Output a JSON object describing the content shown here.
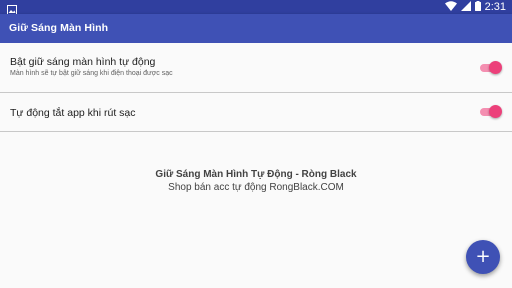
{
  "status_bar": {
    "time": "2:31",
    "left_icon": "image-icon",
    "icons": [
      "wifi-icon",
      "signal-icon",
      "battery-icon"
    ]
  },
  "app_bar": {
    "title": "Giữ Sáng Màn Hình"
  },
  "preferences": [
    {
      "title": "Bật giữ sáng màn hình tự động",
      "summary": "Màn hình sẽ tự bật giữ sáng khi điện thoại được sạc",
      "checked": true
    },
    {
      "title": "Tự động tắt app khi rút sạc",
      "checked": true
    }
  ],
  "center": {
    "title": "Giữ Sáng Màn Hình Tự Động - Ròng Black",
    "subtitle": "Shop bán acc tự động RongBlack.COM"
  },
  "fab": {
    "icon": "plus-icon",
    "symbol": "+"
  },
  "colors": {
    "status_bar": "#303f9f",
    "app_bar": "#3f51b5",
    "accent": "#ec407a",
    "accent_track": "#f48fb1",
    "background": "#fafafa"
  }
}
